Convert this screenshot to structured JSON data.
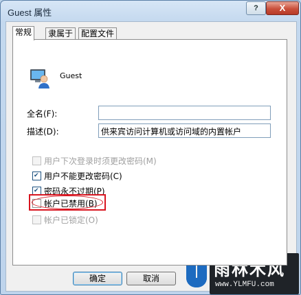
{
  "window": {
    "title": "Guest 属性",
    "help_glyph": "?",
    "close_glyph": "X"
  },
  "tabs": [
    {
      "label": "常规",
      "active": true
    },
    {
      "label": "隶属于",
      "active": false
    },
    {
      "label": "配置文件",
      "active": false
    }
  ],
  "general": {
    "user_icon": "user-account-icon",
    "user_name": "Guest",
    "fullname_label": "全名(F):",
    "fullname_value": "",
    "description_label": "描述(D):",
    "description_value": "供来宾访问计算机或访问域的内置帐户",
    "options": [
      {
        "label": "用户下次登录时须更改密码(M)",
        "checked": false,
        "enabled": false
      },
      {
        "label": "用户不能更改密码(C)",
        "checked": true,
        "enabled": true
      },
      {
        "label": "密码永不过期(P)",
        "checked": true,
        "enabled": true
      },
      {
        "label": "帐户已禁用(B)",
        "checked": false,
        "enabled": true
      },
      {
        "label": "帐户已锁定(O)",
        "checked": false,
        "enabled": false
      }
    ]
  },
  "buttons": {
    "ok": "确定",
    "cancel": "取消"
  },
  "watermark": {
    "title": "雨林木风",
    "url": "www.YLMFU.com"
  },
  "colors": {
    "highlight_red": "#d8141f",
    "accent_blue": "#1d6bc0"
  }
}
